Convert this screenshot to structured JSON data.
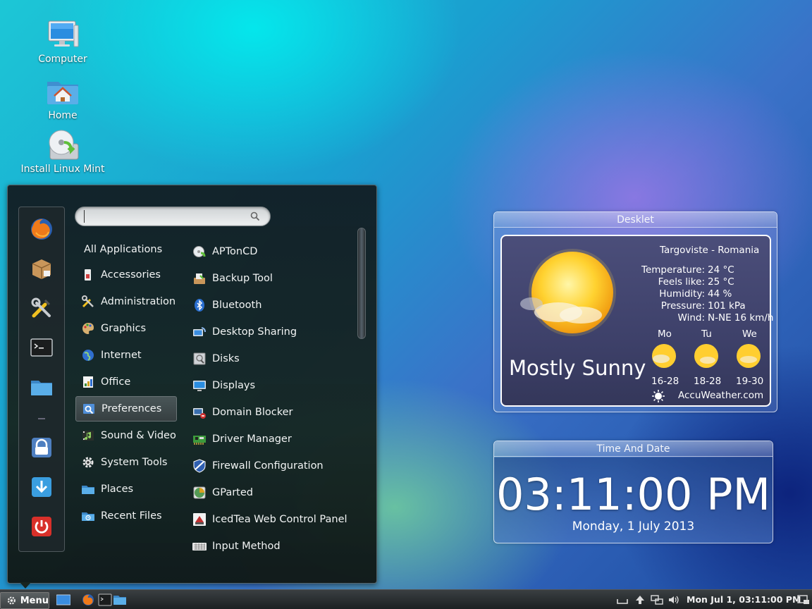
{
  "desktop": {
    "icons": [
      {
        "label": "Computer"
      },
      {
        "label": "Home"
      },
      {
        "label": "Install Linux Mint"
      }
    ]
  },
  "menu": {
    "search": {
      "value": "",
      "placeholder": ""
    },
    "favorites": [
      "firefox-icon",
      "package-icon",
      "tools-icon",
      "terminal-icon",
      "folder-icon",
      "lock-icon",
      "download-icon",
      "power-icon"
    ],
    "categories": [
      {
        "label": "All Applications"
      },
      {
        "label": "Accessories"
      },
      {
        "label": "Administration"
      },
      {
        "label": "Graphics"
      },
      {
        "label": "Internet"
      },
      {
        "label": "Office"
      },
      {
        "label": "Preferences",
        "selected": true
      },
      {
        "label": "Sound & Video"
      },
      {
        "label": "System Tools"
      },
      {
        "label": "Places"
      },
      {
        "label": "Recent Files"
      }
    ],
    "apps": [
      {
        "label": "APTonCD"
      },
      {
        "label": "Backup Tool"
      },
      {
        "label": "Bluetooth"
      },
      {
        "label": "Desktop Sharing"
      },
      {
        "label": "Disks"
      },
      {
        "label": "Displays"
      },
      {
        "label": "Domain Blocker"
      },
      {
        "label": "Driver Manager"
      },
      {
        "label": "Firewall Configuration"
      },
      {
        "label": "GParted"
      },
      {
        "label": "IcedTea Web Control Panel"
      },
      {
        "label": "Input Method"
      }
    ]
  },
  "weather": {
    "title": "Desklet",
    "location": "Targoviste - Romania",
    "rows": [
      {
        "label": "Temperature:",
        "value": "24 °C"
      },
      {
        "label": "Feels like:",
        "value": "25 °C"
      },
      {
        "label": "Humidity:",
        "value": "44 %"
      },
      {
        "label": "Pressure:",
        "value": "101 kPa"
      },
      {
        "label": "Wind:",
        "value": "N-NE 16 km/h"
      }
    ],
    "condition": "Mostly Sunny",
    "forecast": [
      {
        "day": "Mo",
        "range": "16-28"
      },
      {
        "day": "Tu",
        "range": "18-28"
      },
      {
        "day": "We",
        "range": "19-30"
      }
    ],
    "source": "AccuWeather.com"
  },
  "clock": {
    "title": "Time And Date",
    "time": "03:11:00 PM",
    "date": "Monday, 1 July 2013"
  },
  "taskbar": {
    "menu_label": "Menu",
    "clock": "Mon Jul  1, 03:11:00 PM"
  },
  "colors": {
    "menu_selected": "#4a5658",
    "taskbar": "#1c2022"
  }
}
